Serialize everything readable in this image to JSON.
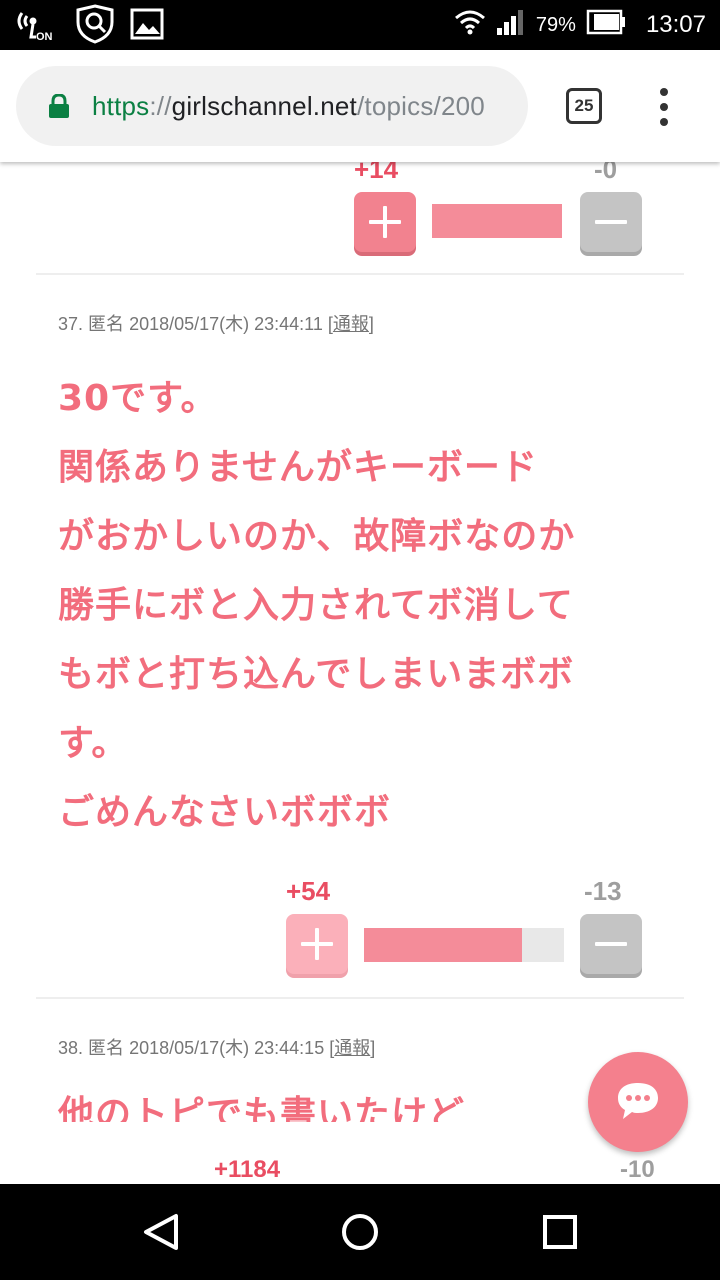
{
  "status_bar": {
    "on_label": "ON",
    "battery_percent": "79%",
    "time": "13:07"
  },
  "browser": {
    "url_scheme": "https",
    "url_separator": "://",
    "url_host": "girlschannel.net",
    "url_path": "/topics/200",
    "tab_count": "25"
  },
  "comments": [
    {
      "votes": {
        "plus": "+14",
        "minus": "-0",
        "ratio": 1.0
      }
    },
    {
      "meta": {
        "number": "37.",
        "author": "匿名",
        "datetime": "2018/05/17(木) 23:44:11",
        "report_open": "[",
        "report_label": "通報",
        "report_close": "]"
      },
      "lines": [
        "30です。",
        "関係ありませんがキーボード",
        "がおかしいのか、故障ボなのか",
        "勝手にボと入力されてボ消して",
        "もボと打ち込んでしまいまボボ",
        "す。",
        "ごめんなさいボボボ"
      ],
      "votes": {
        "plus": "+54",
        "minus": "-13",
        "ratio": 0.79
      }
    },
    {
      "meta": {
        "number": "38.",
        "author": "匿名",
        "datetime": "2018/05/17(木) 23:44:15",
        "report_open": "[",
        "report_label": "通報",
        "report_close": "]"
      },
      "first_line_partial": "他のトピでも書いたけど",
      "votes": {
        "plus": "+1184",
        "minus": "-10"
      }
    }
  ],
  "icons": {
    "status": [
      "nfc-on-icon",
      "shield-search-icon",
      "image-icon",
      "wifi-icon",
      "signal-icon",
      "battery-icon"
    ],
    "browser": [
      "lock-icon",
      "tab-switcher-icon",
      "overflow-menu-icon"
    ],
    "page": [
      "chat-icon",
      "plus-icon",
      "minus-icon"
    ],
    "nav": [
      "back-icon",
      "home-icon",
      "recents-icon"
    ]
  },
  "colors": {
    "accent_pink": "#f26d7d",
    "vote_plus": "#e94d62",
    "vote_minus": "#9e9e9e",
    "secure_green": "#0b8043"
  }
}
